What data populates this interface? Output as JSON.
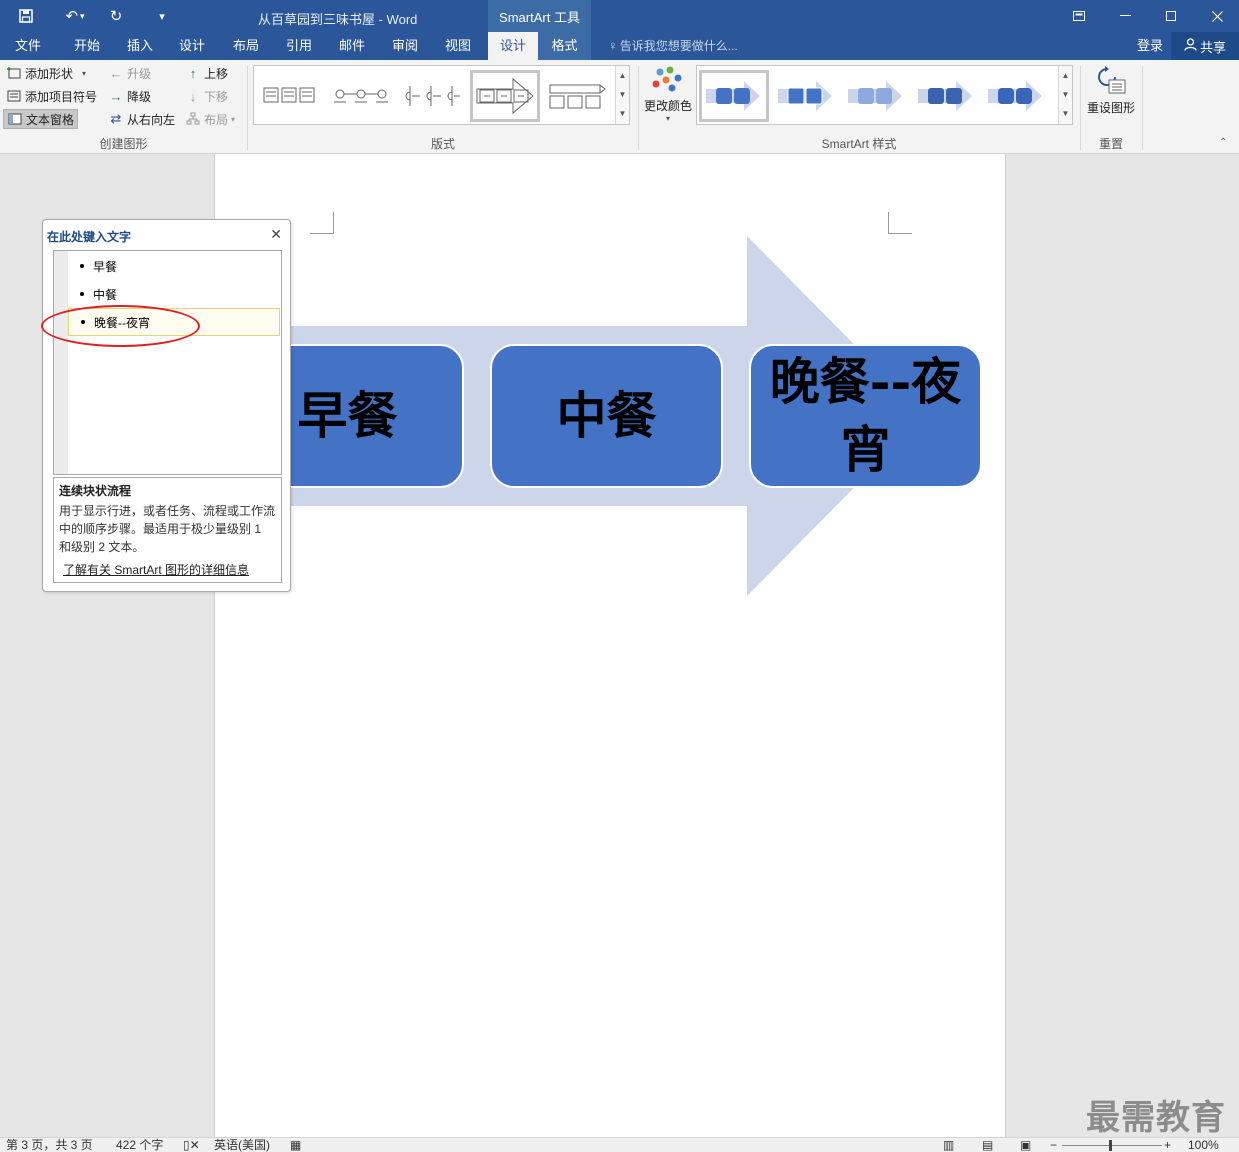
{
  "titlebar": {
    "document_title": "从百草园到三味书屋 - Word",
    "contextual_tools": "SmartArt 工具",
    "quick_access_icons": [
      "save-icon",
      "undo-icon",
      "redo-icon",
      "customize-qat-icon"
    ],
    "window_controls": [
      "ribbon-display-options-icon",
      "minimize-icon",
      "restore-icon",
      "close-icon"
    ]
  },
  "tabs": {
    "file": "文件",
    "home": "开始",
    "insert": "插入",
    "design": "设计",
    "layout": "布局",
    "references": "引用",
    "mailings": "邮件",
    "review": "审阅",
    "view": "视图",
    "smartart_design": "设计",
    "smartart_format": "格式",
    "active": "smartart_design",
    "tell_me": "告诉我您想要做什么...",
    "login": "登录",
    "share": "共享"
  },
  "ribbon": {
    "create_graphic": {
      "label": "创建图形",
      "add_shape": "添加形状",
      "add_bullet": "添加项目符号",
      "text_pane": "文本窗格",
      "promote": "升级",
      "demote": "降级",
      "right_to_left": "从右向左",
      "move_up": "上移",
      "move_down": "下移",
      "layout": "布局"
    },
    "layouts": {
      "label": "版式"
    },
    "styles": {
      "label": "SmartArt 样式",
      "change_colors": "更改颜色"
    },
    "reset": {
      "label": "重置",
      "reset_graphic": "重设图形"
    }
  },
  "smartart": {
    "nodes": [
      "早餐",
      "中餐",
      "晚餐--夜宵"
    ],
    "node_color": "#4472c4",
    "arrow_color": "#cdd5ea"
  },
  "text_pane": {
    "title": "在此处键入文字",
    "items": [
      "早餐",
      "中餐",
      "晚餐--夜宵"
    ],
    "selected_index": 2,
    "description_title": "连续块状流程",
    "description_body": "用于显示行进，或者任务、流程或工作流中的顺序步骤。最适用于极少量级别 1 和级别 2 文本。",
    "learn_more_link": "了解有关 SmartArt 图形的详细信息"
  },
  "watermark": "最需教育",
  "statusbar": {
    "page": "第 3 页，共 3 页",
    "words": "422 个字",
    "language": "英语(美国)",
    "zoom": "100%"
  },
  "colors": {
    "word_blue": "#2b579a",
    "annotation_red": "#e02020"
  }
}
